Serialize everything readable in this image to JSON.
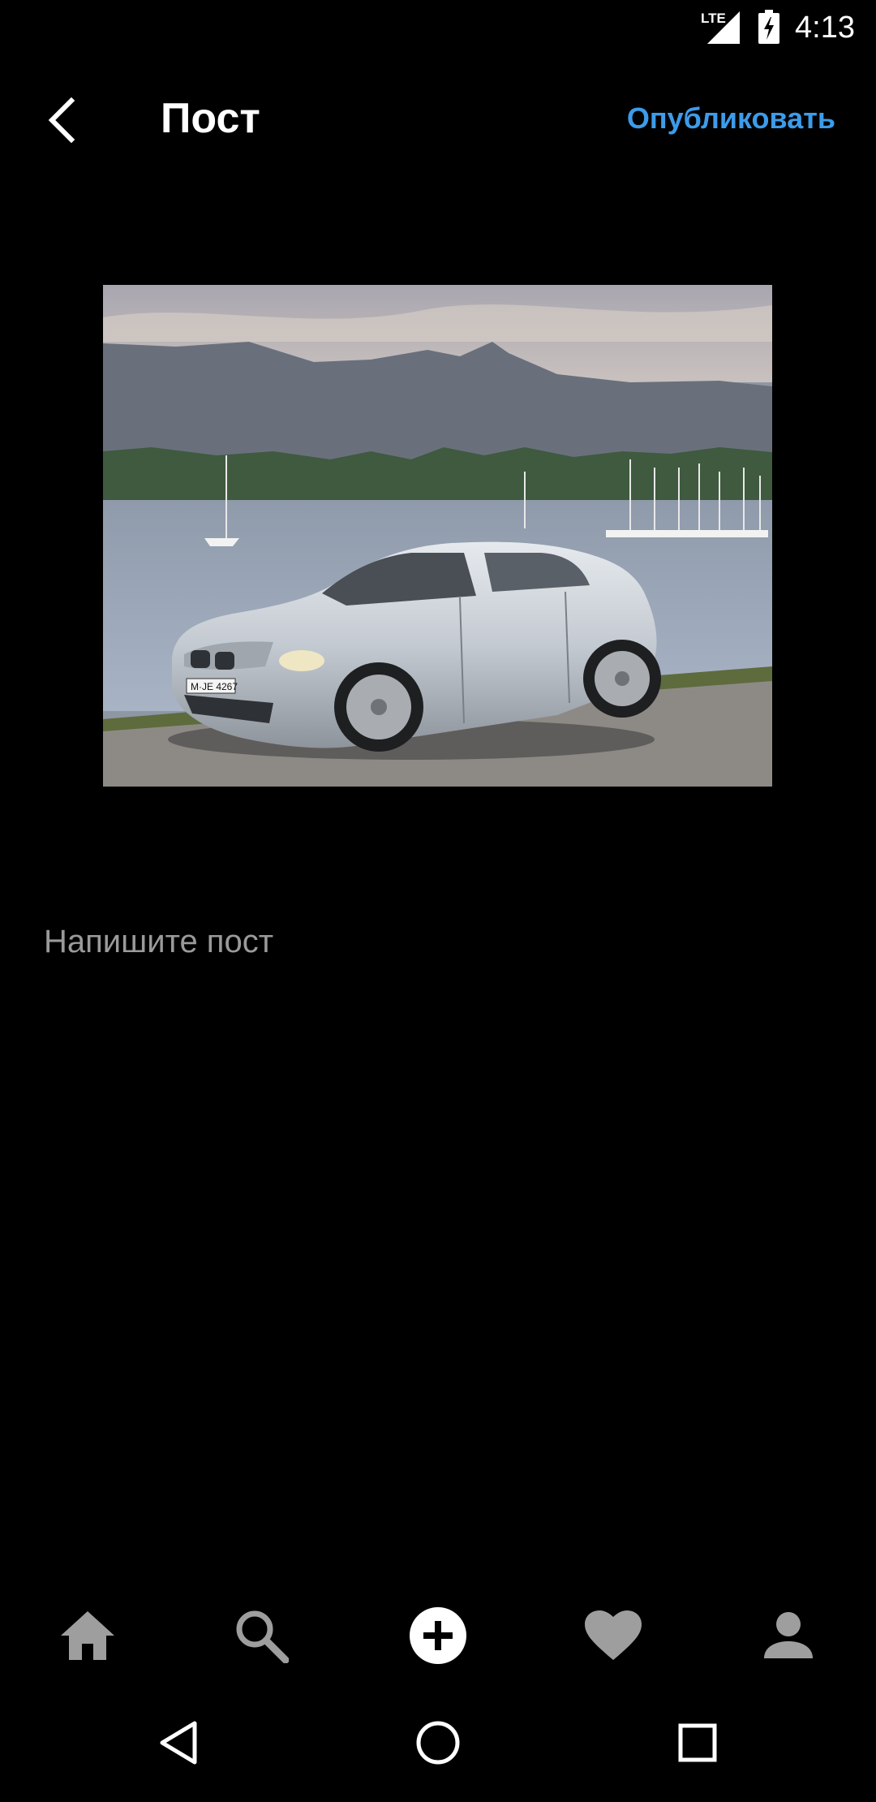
{
  "status_bar": {
    "network": "LTE",
    "time": "4:13",
    "icons": [
      "signal-icon",
      "battery-charging-icon"
    ]
  },
  "app_bar": {
    "back_icon": "chevron-left-icon",
    "title": "Пост",
    "publish_label": "Опубликовать",
    "accent_color": "#3d9be9"
  },
  "photo": {
    "plate_text": "M·JE 4267"
  },
  "post_input": {
    "value": "",
    "placeholder": "Напишите пост"
  },
  "bottom_nav": {
    "items": [
      {
        "icon": "home-icon"
      },
      {
        "icon": "search-icon"
      },
      {
        "icon": "add-circle-icon",
        "active": true
      },
      {
        "icon": "heart-icon"
      },
      {
        "icon": "profile-icon"
      }
    ],
    "active_color": "#ffffff",
    "inactive_color": "#9e9e9e"
  },
  "system_nav": {
    "icons": [
      "back-triangle-icon",
      "home-circle-icon",
      "recents-square-icon"
    ]
  }
}
